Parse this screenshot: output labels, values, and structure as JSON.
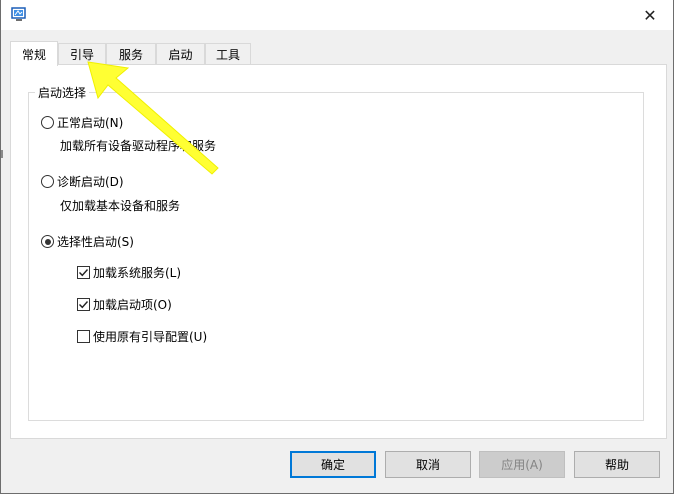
{
  "titlebar": {
    "close_glyph": "✕"
  },
  "tabs": [
    {
      "label": "常规",
      "active": true
    },
    {
      "label": "引导",
      "active": false
    },
    {
      "label": "服务",
      "active": false
    },
    {
      "label": "启动",
      "active": false
    },
    {
      "label": "工具",
      "active": false
    }
  ],
  "startup": {
    "group_title": "启动选择",
    "normal": {
      "label": "正常启动(N)",
      "desc": "加载所有设备驱动程序和服务",
      "selected": false
    },
    "diagnostic": {
      "label": "诊断启动(D)",
      "desc": "仅加载基本设备和服务",
      "selected": false
    },
    "selective": {
      "label": "选择性启动(S)",
      "selected": true
    },
    "options": [
      {
        "label": "加载系统服务(L)",
        "checked": true
      },
      {
        "label": "加载启动项(O)",
        "checked": true
      },
      {
        "label": "使用原有引导配置(U)",
        "checked": false
      }
    ]
  },
  "buttons": {
    "ok": "确定",
    "cancel": "取消",
    "apply": "应用(A)",
    "help": "帮助"
  },
  "colors": {
    "arrow": "#ffff33",
    "accent": "#0078d7"
  },
  "icons": {
    "app": "msconfig-icon",
    "close": "close-icon",
    "check": "checkmark-icon",
    "annotation": "arrow-icon"
  }
}
